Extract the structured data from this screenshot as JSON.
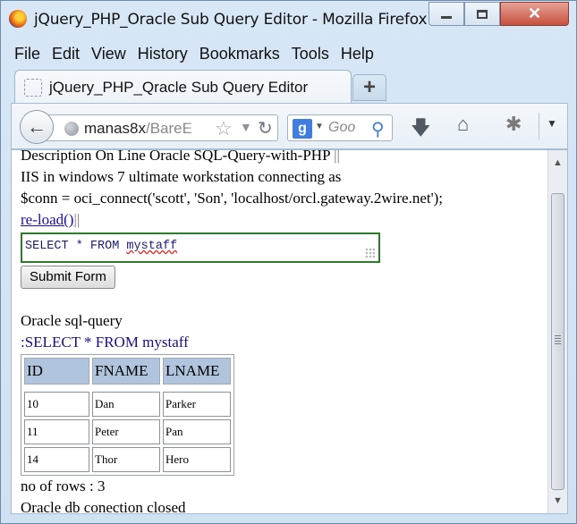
{
  "window": {
    "title": "jQuery_PHP_Oracle Sub Query Editor - Mozilla Firefox",
    "min_symbol": "",
    "close_symbol": "✕"
  },
  "menubar": {
    "items": [
      "File",
      "Edit",
      "View",
      "History",
      "Bookmarks",
      "Tools",
      "Help"
    ]
  },
  "tab": {
    "title": "jQuery_PHP_Qracle Sub Query Editor",
    "new_tab_symbol": "+"
  },
  "navbar": {
    "back_symbol": "←",
    "url_host": "manas8x",
    "url_path": "/BareE",
    "search_placeholder": "Goo",
    "search_engine_letter": "g"
  },
  "page": {
    "line1_text": "Description On Line Oracle SQL-Query-with-PHP",
    "line1_sep": " ||",
    "line2": "IIS in windows 7 ultimate workstation connecting as",
    "line3": "$conn = oci_connect('scott', 'Son', 'localhost/orcl.gateway.2wire.net');",
    "reload_link": "re-load()",
    "reload_sep": "||",
    "sql_prefix": "SELECT * FROM ",
    "sql_table": "mystaff",
    "submit_label": "Submit Form",
    "result_heading": "Oracle sql-query",
    "query_echo": ":SELECT * FROM mystaff",
    "table": {
      "headers": [
        "ID",
        "FNAME",
        "LNAME"
      ],
      "rows": [
        [
          "10",
          "Dan",
          "Parker"
        ],
        [
          "11",
          "Peter",
          "Pan"
        ],
        [
          "14",
          "Thor",
          "Hero"
        ]
      ]
    },
    "row_count": "no of rows : 3",
    "closed_msg": "Oracle db conection closed"
  }
}
